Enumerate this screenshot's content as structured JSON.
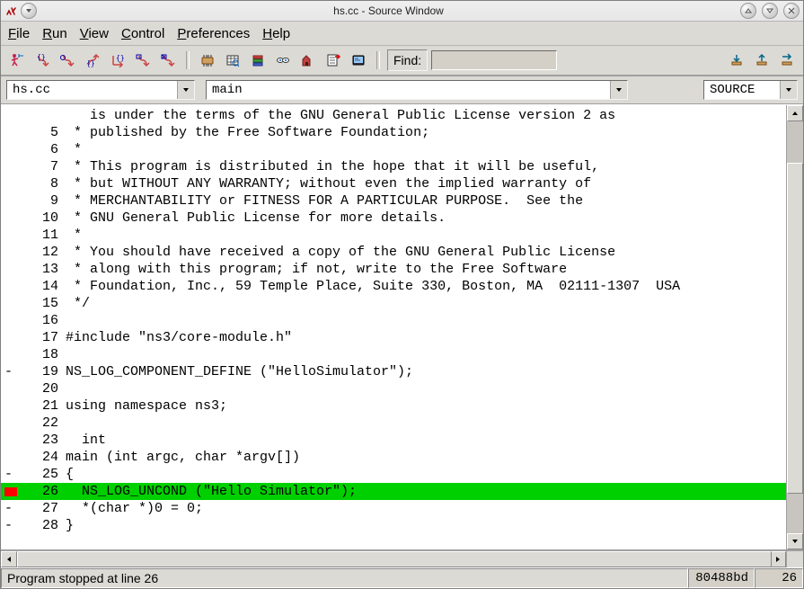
{
  "title": "hs.cc - Source Window",
  "menus": {
    "file": {
      "label": "File",
      "ul": "F",
      "rest": "ile"
    },
    "run": {
      "label": "Run",
      "ul": "R",
      "rest": "un"
    },
    "view": {
      "label": "View",
      "ul": "V",
      "rest": "iew"
    },
    "control": {
      "label": "Control",
      "ul": "C",
      "rest": "ontrol"
    },
    "preferences": {
      "label": "Preferences",
      "ul": "P",
      "rest": "references"
    },
    "help": {
      "label": "Help",
      "ul": "H",
      "rest": "elp"
    }
  },
  "find": {
    "label": "Find:",
    "value": ""
  },
  "selectors": {
    "file": "hs.cc",
    "function": "main",
    "mode": "SOURCE"
  },
  "source": {
    "highlighted_line": 26,
    "lines": [
      {
        "n": null,
        "mark": "",
        "text": "   is under the terms of the GNU General Public License version 2 as"
      },
      {
        "n": 5,
        "mark": "",
        "text": " * published by the Free Software Foundation;"
      },
      {
        "n": 6,
        "mark": "",
        "text": " *"
      },
      {
        "n": 7,
        "mark": "",
        "text": " * This program is distributed in the hope that it will be useful,"
      },
      {
        "n": 8,
        "mark": "",
        "text": " * but WITHOUT ANY WARRANTY; without even the implied warranty of"
      },
      {
        "n": 9,
        "mark": "",
        "text": " * MERCHANTABILITY or FITNESS FOR A PARTICULAR PURPOSE.  See the"
      },
      {
        "n": 10,
        "mark": "",
        "text": " * GNU General Public License for more details."
      },
      {
        "n": 11,
        "mark": "",
        "text": " *"
      },
      {
        "n": 12,
        "mark": "",
        "text": " * You should have received a copy of the GNU General Public License"
      },
      {
        "n": 13,
        "mark": "",
        "text": " * along with this program; if not, write to the Free Software"
      },
      {
        "n": 14,
        "mark": "",
        "text": " * Foundation, Inc., 59 Temple Place, Suite 330, Boston, MA  02111-1307  USA"
      },
      {
        "n": 15,
        "mark": "",
        "text": " */"
      },
      {
        "n": 16,
        "mark": "",
        "text": ""
      },
      {
        "n": 17,
        "mark": "",
        "text": "#include \"ns3/core-module.h\""
      },
      {
        "n": 18,
        "mark": "",
        "text": ""
      },
      {
        "n": 19,
        "mark": "-",
        "text": "NS_LOG_COMPONENT_DEFINE (\"HelloSimulator\");"
      },
      {
        "n": 20,
        "mark": "",
        "text": ""
      },
      {
        "n": 21,
        "mark": "",
        "text": "using namespace ns3;"
      },
      {
        "n": 22,
        "mark": "",
        "text": ""
      },
      {
        "n": 23,
        "mark": "",
        "text": "  int"
      },
      {
        "n": 24,
        "mark": "",
        "text": "main (int argc, char *argv[])"
      },
      {
        "n": 25,
        "mark": "-",
        "text": "{"
      },
      {
        "n": 26,
        "mark": "bp",
        "text": "  NS_LOG_UNCOND (\"Hello Simulator\");"
      },
      {
        "n": 27,
        "mark": "-",
        "text": "  *(char *)0 = 0;"
      },
      {
        "n": 28,
        "mark": "-",
        "text": "}"
      }
    ]
  },
  "status": {
    "message": "Program stopped at line 26",
    "address": "80488bd",
    "line": "26"
  }
}
